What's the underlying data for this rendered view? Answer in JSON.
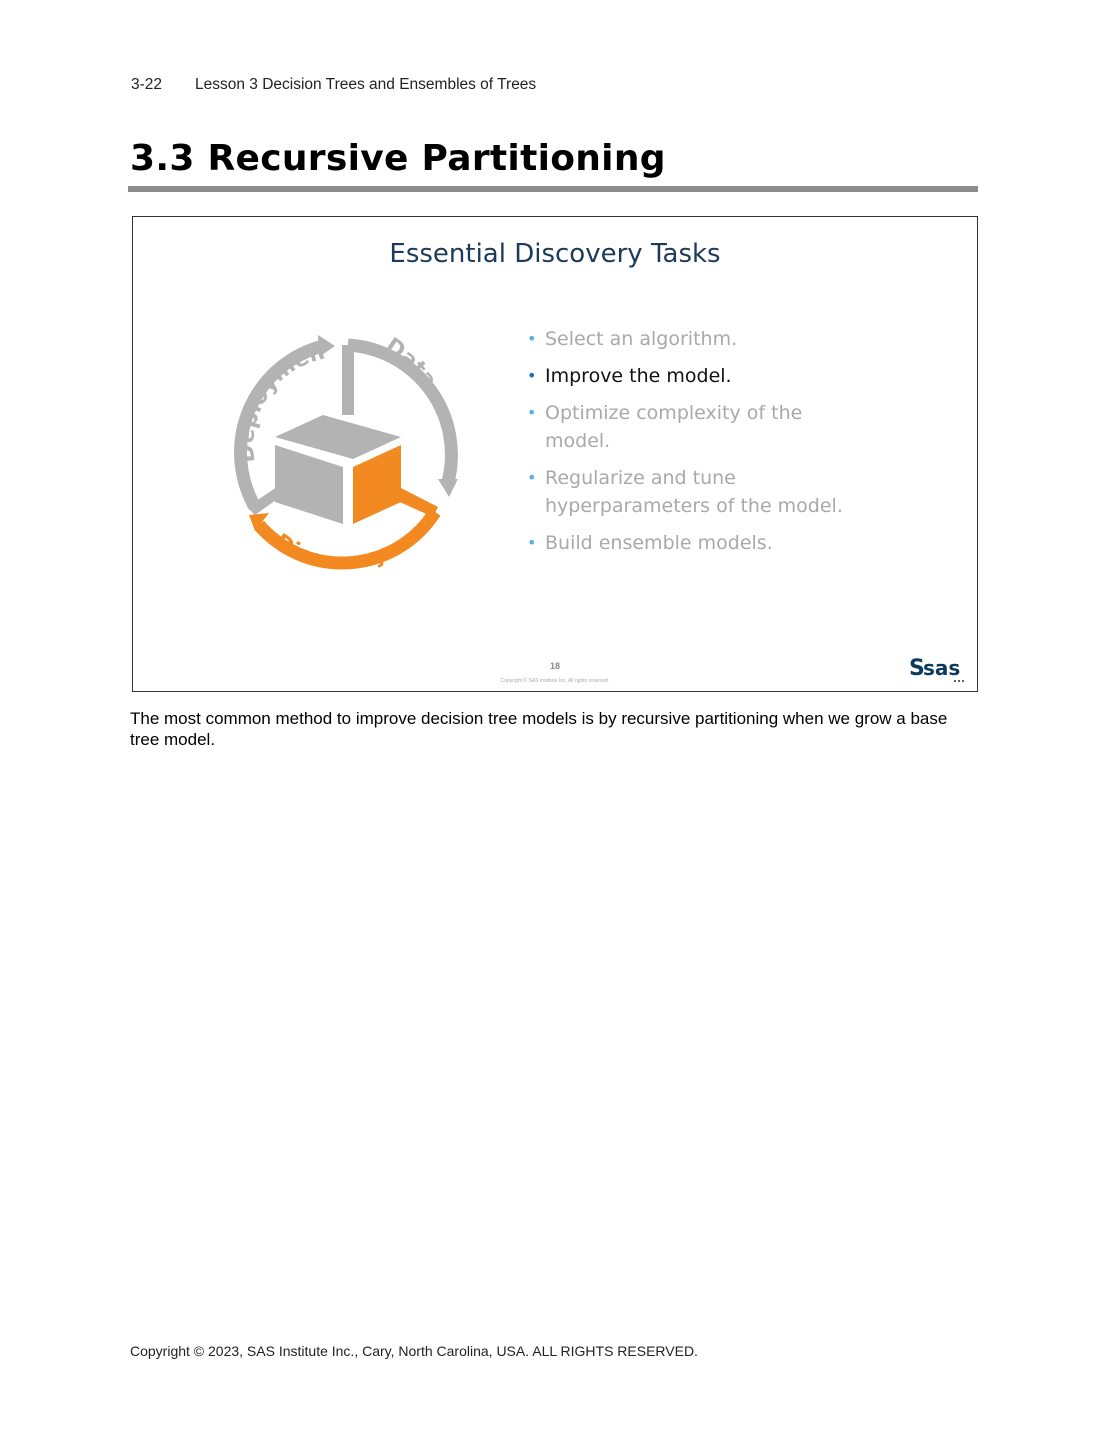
{
  "header": {
    "page_number": "3-22",
    "lesson": "Lesson 3  Decision Trees and Ensembles of Trees"
  },
  "section_heading": "3.3 Recursive Partitioning",
  "slide": {
    "title": "Essential Discovery Tasks",
    "cycle_labels": {
      "deployment": "Deployment",
      "data": "Data",
      "discovery": "Discovery"
    },
    "bullets": [
      {
        "text": "Select an algorithm.",
        "active": false
      },
      {
        "text": "Improve the model.",
        "active": true
      },
      {
        "text": "Optimize complexity of the model.",
        "active": false
      },
      {
        "text": "Regularize and tune hyperparameters of the model.",
        "active": false
      },
      {
        "text": "Build ensemble models.",
        "active": false
      }
    ],
    "slide_number": "18",
    "copyright": "Copyright © SAS Institute Inc. All rights reserved.",
    "logo_text": "sas"
  },
  "body_text": "The most common method to improve decision tree models is by recursive partitioning when we grow a base tree model.",
  "footer": "Copyright © 2023, SAS Institute Inc., Cary, North Carolina, USA. ALL RIGHTS RESERVED.",
  "colors": {
    "heading_rule": "#8c8c8c",
    "slide_title": "#1d3a5a",
    "cycle_gray": "#b3b3b3",
    "cycle_orange": "#f28a21",
    "bullet_inactive": "#a9a9a9",
    "bullet_active": "#111111"
  }
}
